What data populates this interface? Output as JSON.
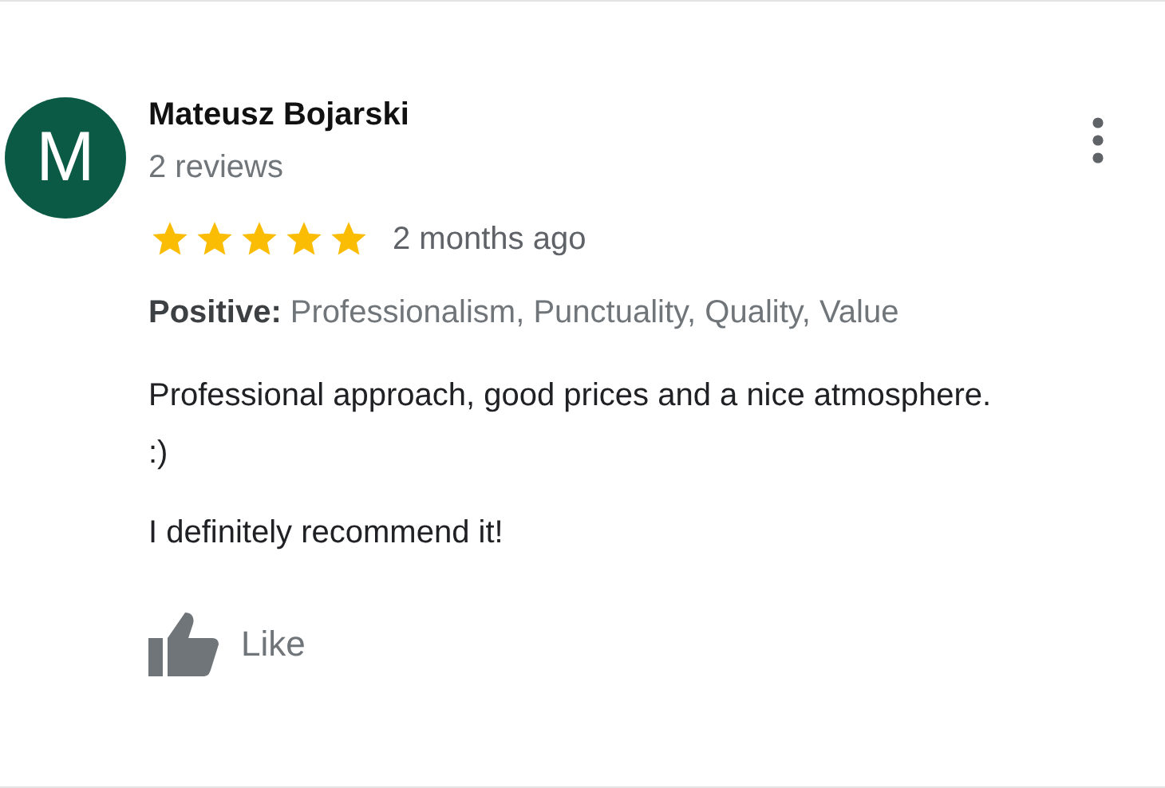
{
  "review": {
    "avatar_letter": "M",
    "author": "Mateusz Bojarski",
    "reviews_count": "2 reviews",
    "stars": 5,
    "time": "2 months ago",
    "attributes": {
      "label": "Positive:",
      "values": "Professionalism, Punctuality, Quality, Value"
    },
    "paragraphs": [
      "Professional approach, good prices and a nice atmosphere. :)",
      "I definitely recommend it!"
    ],
    "like_label": "Like"
  }
}
